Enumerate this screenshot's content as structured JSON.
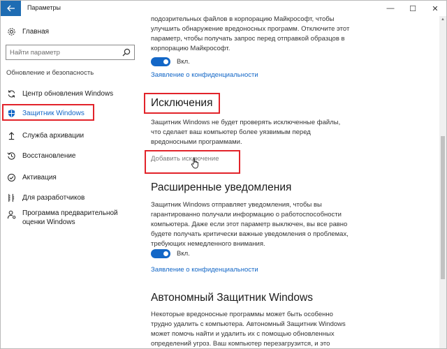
{
  "window": {
    "title": "Параметры",
    "controls": {
      "minimize": "—",
      "maximize": "☐",
      "close": "✕"
    }
  },
  "sidebar": {
    "home_label": "Главная",
    "search_placeholder": "Найти параметр",
    "section_heading": "Обновление и безопасность",
    "items": [
      {
        "label": "Центр обновления Windows",
        "icon": "sync-icon"
      },
      {
        "label": "Защитник Windows",
        "icon": "shield-icon",
        "active": true
      },
      {
        "label": "Служба архивации",
        "icon": "backup-arrow-icon"
      },
      {
        "label": "Восстановление",
        "icon": "history-icon"
      },
      {
        "label": "Активация",
        "icon": "check-circle-icon"
      },
      {
        "label": "Для разработчиков",
        "icon": "developer-tools-icon"
      },
      {
        "label": "Программа предварительной оценки Windows",
        "icon": "person-icon"
      }
    ]
  },
  "content": {
    "sample_text": "подозрительных файлов в корпорацию Майкрософт, чтобы улучшить обнаружение вредоносных программ. Отключите этот параметр, чтобы получать запрос перед отправкой образцов в корпорацию Майкрософт.",
    "sample_toggle_label": "Вкл.",
    "privacy_link_1": "Заявление о конфиденциальности",
    "exclusions_title": "Исключения",
    "exclusions_text": "Защитник Windows не будет проверять исключенные файлы, что сделает ваш компьютер более уязвимым перед вредоносными программами.",
    "add_exclusion": "Добавить исключение",
    "notifications_title": "Расширенные уведомления",
    "notifications_text": "Защитник Windows отправляет уведомления, чтобы вы гарантированно получали информацию о работоспособности компьютера. Даже если этот параметр выключен, вы все равно будете получать критически важные уведомления о проблемах, требующих немедленного внимания.",
    "notifications_toggle_label": "Вкл.",
    "privacy_link_2": "Заявление о конфиденциальности",
    "offline_title": "Автономный Защитник Windows",
    "offline_text": "Некоторые вредоносные программы может быть особенно трудно удалить с компьютера. Автономный Защитник Windows может помочь найти и удалить их с помощью обновленных определений угроз. Ваш компьютер перезагрузится, и это"
  },
  "colors": {
    "accent": "#1367c7",
    "titlebar_back": "#1e6cb3",
    "highlight_box": "#e2232a"
  }
}
